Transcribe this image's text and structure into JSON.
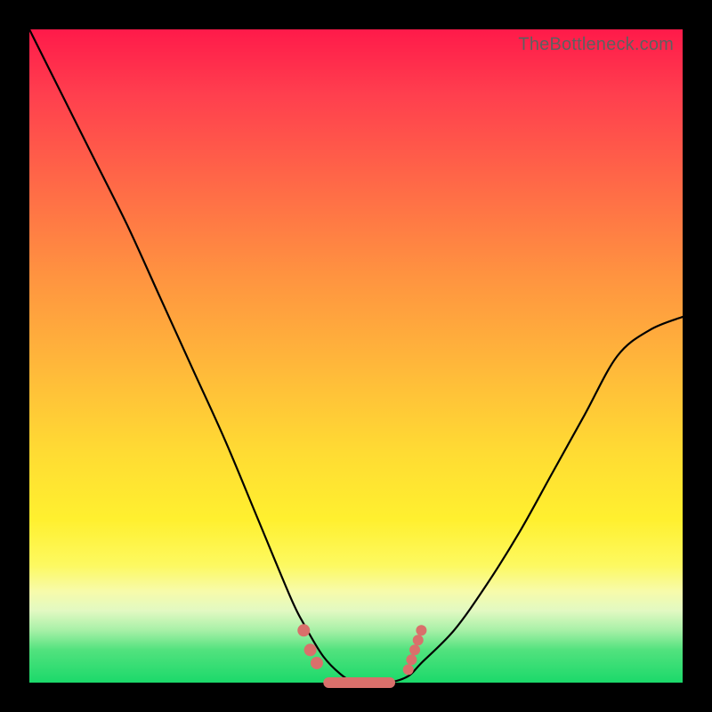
{
  "watermark": "TheBottleneck.com",
  "chart_data": {
    "type": "line",
    "title": "",
    "xlabel": "",
    "ylabel": "",
    "xlim": [
      0,
      100
    ],
    "ylim": [
      0,
      100
    ],
    "grid": false,
    "legend": false,
    "series": [
      {
        "name": "bottleneck-curve",
        "x": [
          0,
          5,
          10,
          15,
          20,
          25,
          30,
          35,
          40,
          42,
          45,
          48,
          50,
          52,
          55,
          58,
          60,
          65,
          70,
          75,
          80,
          85,
          90,
          95,
          100
        ],
        "y": [
          100,
          90,
          80,
          70,
          59,
          48,
          37,
          25,
          13,
          9,
          4,
          1,
          0,
          0,
          0,
          1,
          3,
          8,
          15,
          23,
          32,
          41,
          50,
          54,
          56
        ]
      }
    ],
    "markers": {
      "left_cluster": {
        "x": [
          42,
          43,
          44
        ],
        "y": [
          8,
          5,
          3
        ]
      },
      "right_cluster": {
        "x": [
          58,
          58.5,
          59,
          59.5,
          60
        ],
        "y": [
          2,
          3.5,
          5,
          6.5,
          8
        ]
      },
      "bottom_pill": {
        "x_start": 45,
        "x_end": 56,
        "y": 0
      }
    },
    "background_gradient": {
      "top": "#ff1a4a",
      "upper_mid": "#ffb93a",
      "lower_mid": "#fff02f",
      "bottom": "#1bd96a"
    }
  }
}
